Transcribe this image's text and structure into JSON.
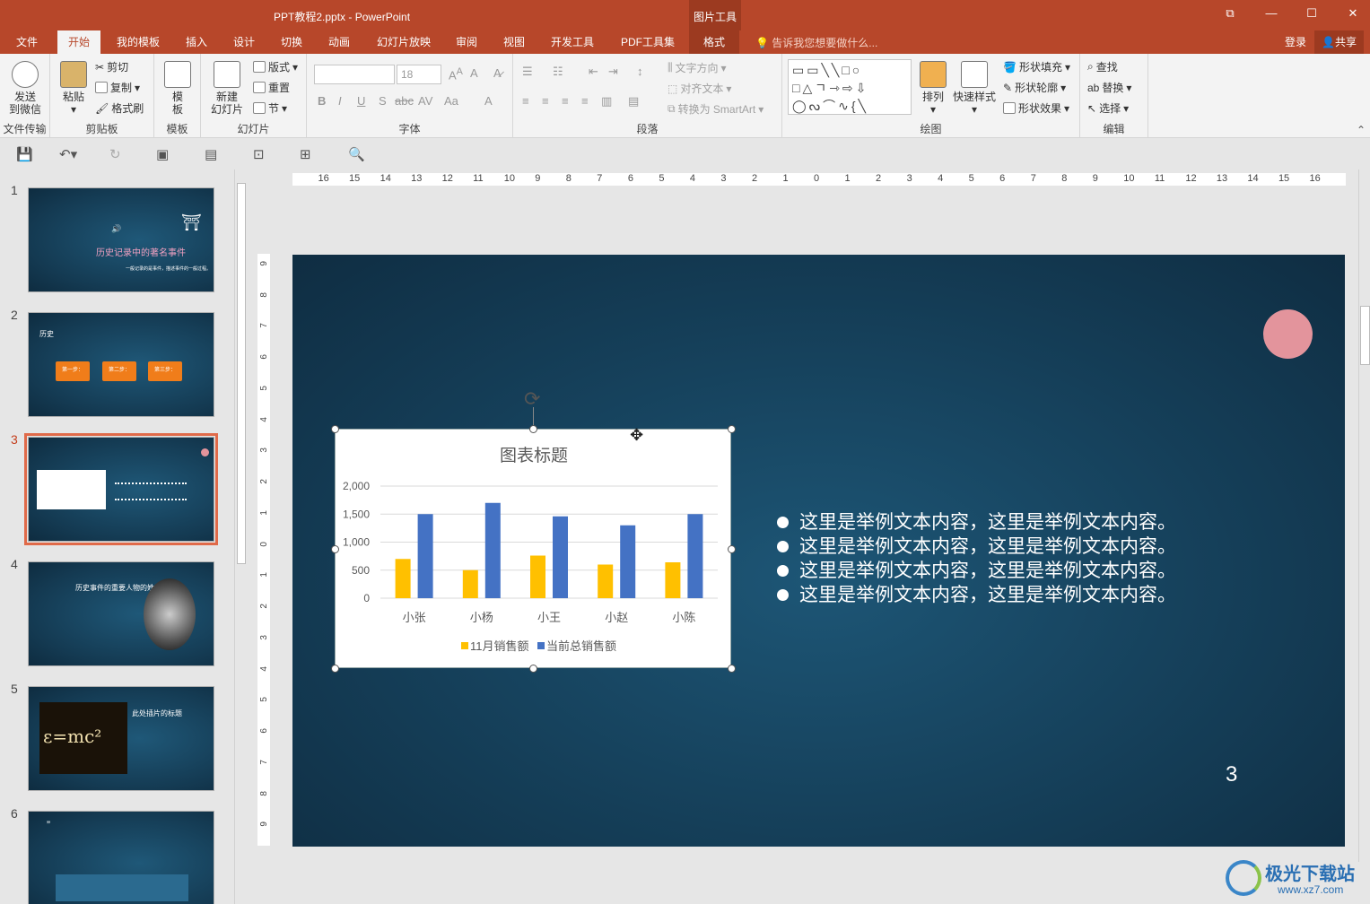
{
  "window": {
    "title": "PPT教程2.pptx - PowerPoint",
    "context_tool": "图片工具",
    "min_icon": "minimize-icon",
    "max_icon": "maximize-icon",
    "close_glyph": "✕",
    "min_glyph": "—",
    "max_glyph": "☐",
    "restore_glyph": "⧉"
  },
  "tabs": [
    {
      "label": "文件"
    },
    {
      "label": "开始"
    },
    {
      "label": "我的模板"
    },
    {
      "label": "插入"
    },
    {
      "label": "设计"
    },
    {
      "label": "切换"
    },
    {
      "label": "动画"
    },
    {
      "label": "幻灯片放映"
    },
    {
      "label": "审阅"
    },
    {
      "label": "视图"
    },
    {
      "label": "开发工具"
    },
    {
      "label": "PDF工具集"
    },
    {
      "label": "格式"
    }
  ],
  "tell_me": "告诉我您想要做什么...",
  "login": "登录",
  "share": "共享",
  "ribbon": {
    "send_to_wechat": [
      "发送",
      "到微信"
    ],
    "group_file_transfer": "文件传输",
    "paste": "粘贴",
    "cut": "剪切",
    "copy": "复制",
    "format_painter": "格式刷",
    "group_clipboard": "剪贴板",
    "template": [
      "模",
      "板"
    ],
    "group_template": "模板",
    "new_slide": [
      "新建",
      "幻灯片"
    ],
    "layout": "版式",
    "reset": "重置",
    "section": "节",
    "group_slides": "幻灯片",
    "font_size": "18",
    "group_font": "字体",
    "text_direction": "文字方向",
    "align_text": "对齐文本",
    "convert_smartart": "转换为 SmartArt",
    "group_paragraph": "段落",
    "arrange": "排列",
    "quick_styles": "快速样式",
    "shape_fill": "形状填充",
    "shape_outline": "形状轮廓",
    "shape_effects": "形状效果",
    "group_drawing": "绘图",
    "find": "查找",
    "replace": "替换",
    "select": "选择",
    "group_editing": "编辑"
  },
  "thumbnails": [
    {
      "num": "1",
      "title": "历史记录中的著名事件",
      "sub": "一般记录的是事件，描述事件的一般过程。"
    },
    {
      "num": "2",
      "title": "历史",
      "steps": [
        "第一步：",
        "第二步：",
        "第三步："
      ]
    },
    {
      "num": "3"
    },
    {
      "num": "4",
      "title": "历史事件的重要人物的姓名"
    },
    {
      "num": "5",
      "title": "此处插片的标题"
    },
    {
      "num": "6"
    }
  ],
  "ruler": {
    "h": [
      "16",
      "15",
      "14",
      "13",
      "12",
      "11",
      "10",
      "9",
      "8",
      "7",
      "6",
      "5",
      "4",
      "3",
      "2",
      "1",
      "0",
      "1",
      "2",
      "3",
      "4",
      "5",
      "6",
      "7",
      "8",
      "9",
      "10",
      "11",
      "12",
      "13",
      "14",
      "15",
      "16"
    ],
    "v": [
      "9",
      "8",
      "7",
      "6",
      "5",
      "4",
      "3",
      "2",
      "1",
      "0",
      "1",
      "2",
      "3",
      "4",
      "5",
      "6",
      "7",
      "8",
      "9"
    ]
  },
  "slide": {
    "page_number": "3",
    "bullets": [
      "这里是举例文本内容，这里是举例文本内容。",
      "这里是举例文本内容，这里是举例文本内容。",
      "这里是举例文本内容，这里是举例文本内容。",
      "这里是举例文本内容，这里是举例文本内容。"
    ]
  },
  "chart_data": {
    "type": "bar",
    "title": "图表标题",
    "categories": [
      "小张",
      "小杨",
      "小王",
      "小赵",
      "小陈"
    ],
    "series": [
      {
        "name": "11月销售额",
        "color": "#ffc000",
        "values": [
          700,
          500,
          760,
          600,
          640
        ]
      },
      {
        "name": "当前总销售额",
        "color": "#4472c4",
        "values": [
          1500,
          1700,
          1460,
          1300,
          1500
        ]
      }
    ],
    "ylim": [
      0,
      2000
    ],
    "yticks": [
      "0",
      "500",
      "1,000",
      "1,500",
      "2,000"
    ],
    "grid": true,
    "legend": "bottom"
  },
  "watermark": {
    "name": "极光下载站",
    "url": "www.xz7.com"
  }
}
